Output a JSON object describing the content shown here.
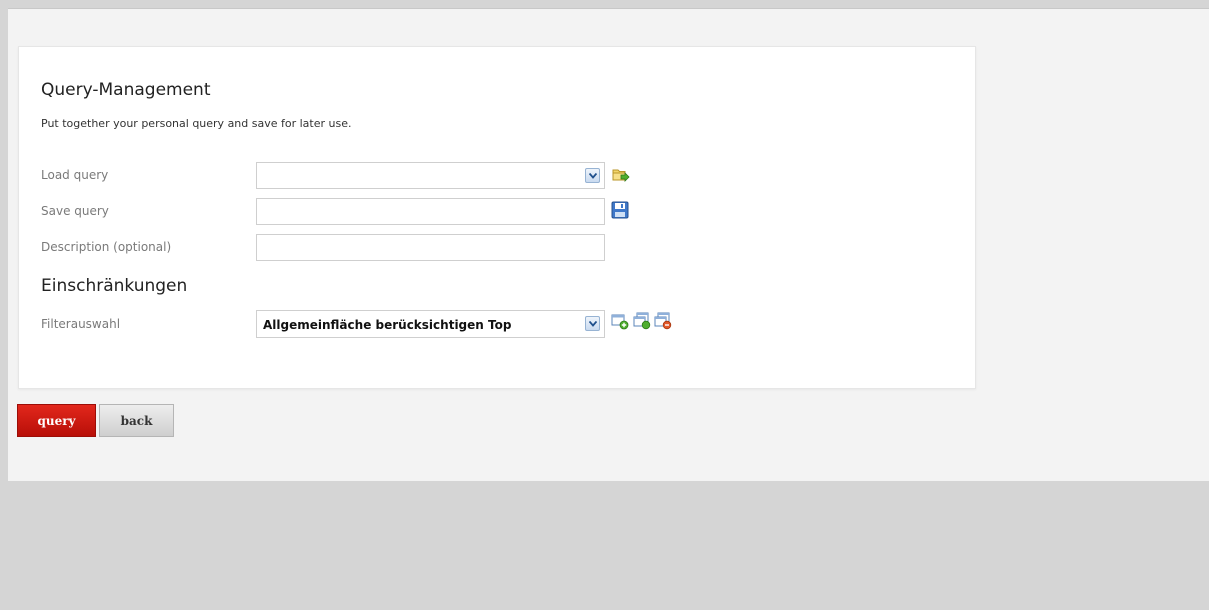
{
  "panel": {
    "title": "Query-Management",
    "description": "Put together your personal query and save for later use."
  },
  "load_query": {
    "label": "Load query",
    "value": "",
    "icon": "folder-arrow-icon"
  },
  "save_query": {
    "label": "Save query",
    "value": "",
    "icon": "floppy-disk-icon"
  },
  "description_field": {
    "label": "Description (optional)",
    "value": ""
  },
  "restrictions": {
    "title": "Einschränkungen",
    "filter_label": "Filterauswahl",
    "filter_value": "Allgemeinfläche berücksichtigen Top",
    "icons": [
      "add-filter-icon",
      "edit-filter-icon",
      "delete-filter-icon"
    ]
  },
  "buttons": {
    "query_label": "query",
    "back_label": "back"
  },
  "colors": {
    "query_button": "#d4190f",
    "page_background": "#f3f3f3",
    "lower_background": "#d5d5d5"
  }
}
